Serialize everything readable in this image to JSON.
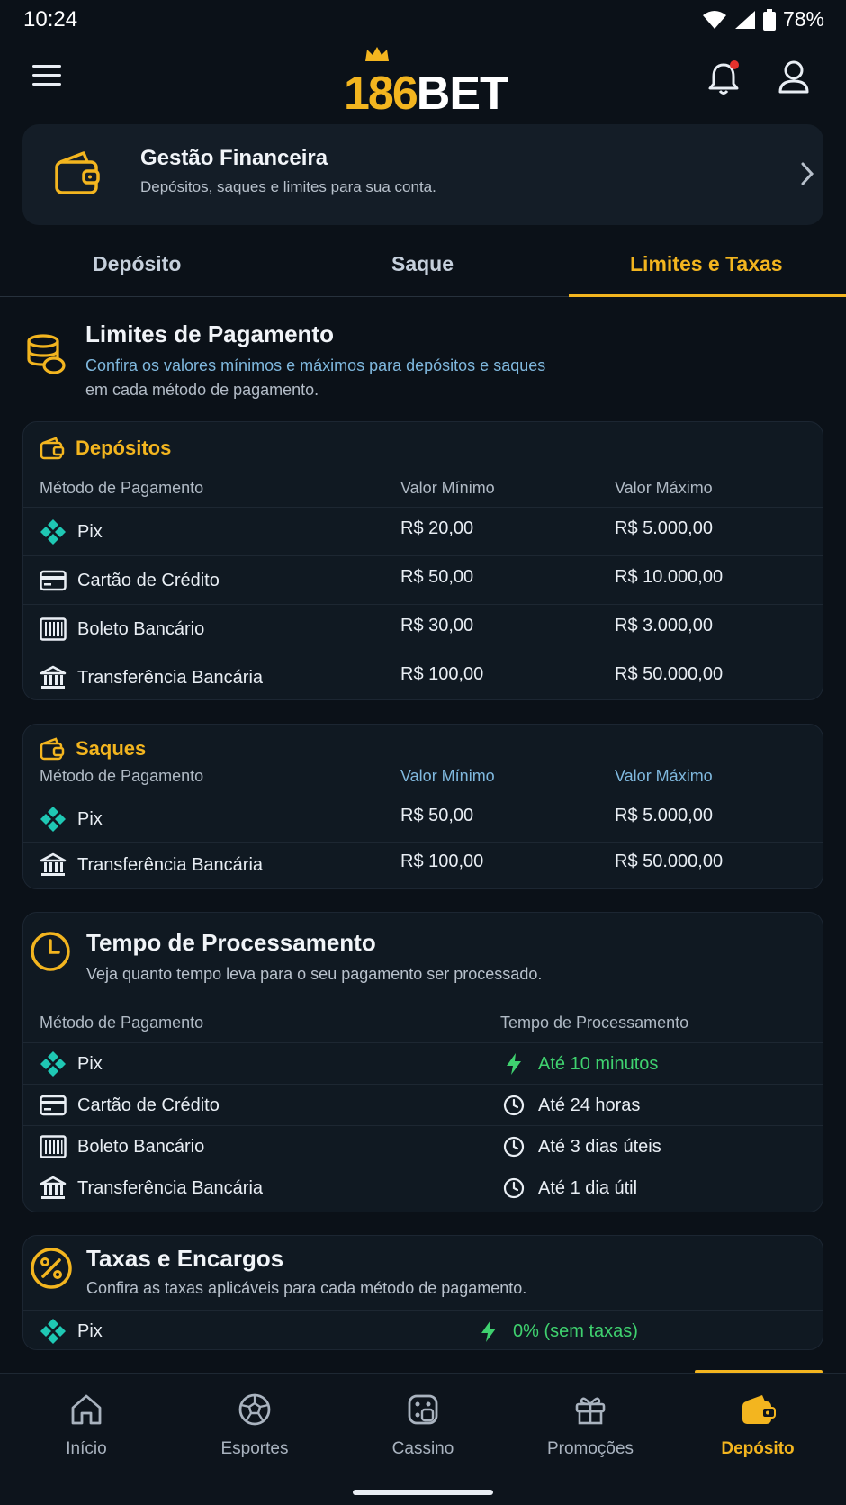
{
  "status": {
    "time": "10:24",
    "battery": "78%"
  },
  "appbar": {
    "logo_num": "186",
    "logo_txt": "BET"
  },
  "finance": {
    "title": "Gestão Financeira",
    "subtitle": "Depósitos, saques e limites para sua conta."
  },
  "tabs": [
    {
      "label": "Depósito"
    },
    {
      "label": "Saque"
    },
    {
      "label": "Limites e Taxas",
      "active": true
    }
  ],
  "limits": {
    "title": "Limites de Pagamento",
    "subtitle_line1": "Confira os valores mínimos e máximos para depósitos e saques",
    "subtitle_line2": "em cada método de pagamento."
  },
  "deposits": {
    "label": "Depósitos",
    "headers": {
      "method": "Método de Pagamento",
      "min": "Valor Mínimo",
      "max": "Valor Máximo"
    },
    "rows": [
      {
        "icon": "pix-icon",
        "method": "Pix",
        "min": "R$ 20,00",
        "max": "R$ 5.000,00"
      },
      {
        "icon": "credit-card-icon",
        "method": "Cartão de Crédito",
        "min": "R$ 50,00",
        "max": "R$ 10.000,00"
      },
      {
        "icon": "barcode-icon",
        "method": "Boleto Bancário",
        "min": "R$ 30,00",
        "max": "R$ 3.000,00"
      },
      {
        "icon": "bank-icon",
        "method": "Transferência Bancária",
        "min": "R$ 100,00",
        "max": "R$ 50.000,00"
      }
    ]
  },
  "withdrawals": {
    "label": "Saques",
    "headers": {
      "method": "Método de Pagamento",
      "min": "Valor Mínimo",
      "max": "Valor Máximo"
    },
    "rows": [
      {
        "icon": "pix-icon",
        "method": "Pix",
        "min": "R$ 50,00",
        "max": "R$ 5.000,00"
      },
      {
        "icon": "bank-icon",
        "method": "Transferência Bancária",
        "min": "R$ 100,00",
        "max": "R$ 50.000,00"
      }
    ]
  },
  "processing": {
    "title": "Tempo de Processamento",
    "subtitle": "Veja quanto tempo leva para o seu pagamento ser processado.",
    "headers": {
      "method": "Método de Pagamento",
      "time": "Tempo de Processamento"
    },
    "rows": [
      {
        "icon": "pix-icon",
        "method": "Pix",
        "time_icon": "lightning-icon",
        "time": "Até 10 minutos"
      },
      {
        "icon": "credit-card-icon",
        "method": "Cartão de Crédito",
        "time_icon": "clock-icon",
        "time": "Até 24 horas"
      },
      {
        "icon": "barcode-icon",
        "method": "Boleto Bancário",
        "time_icon": "clock-icon",
        "time": "Até 3 dias úteis"
      },
      {
        "icon": "bank-icon",
        "method": "Transferência Bancária",
        "time_icon": "clock-icon",
        "time": "Até 1 dia útil"
      }
    ]
  },
  "fees": {
    "title": "Taxas e Encargos",
    "subtitle": "Confira as taxas aplicáveis para cada método de pagamento.",
    "rows": [
      {
        "icon": "pix-icon",
        "method": "Pix",
        "fee": "0% (sem taxas)"
      }
    ]
  },
  "nav": [
    {
      "icon": "home-icon",
      "label": "Início"
    },
    {
      "icon": "soccer-ball-icon",
      "label": "Esportes"
    },
    {
      "icon": "dice-icon",
      "label": "Cassino"
    },
    {
      "icon": "gift-icon",
      "label": "Promoções"
    },
    {
      "icon": "wallet-icon",
      "label": "Depósito",
      "active": true
    }
  ],
  "colors": {
    "accent": "#f3b51f",
    "pix": "#1fc8b4",
    "success": "#3fd16f",
    "background": "#0b1118"
  }
}
